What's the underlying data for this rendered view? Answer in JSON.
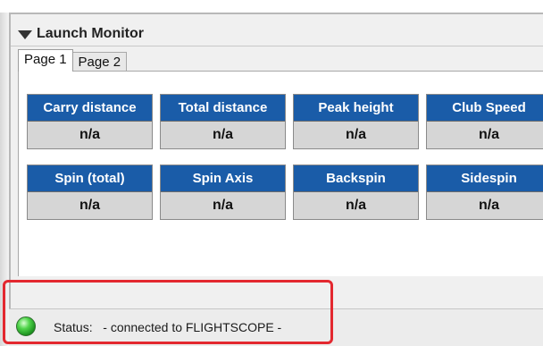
{
  "panel": {
    "title": "Launch Monitor"
  },
  "tabs": [
    {
      "label": "Page 1",
      "active": true
    },
    {
      "label": "Page 2",
      "active": false
    }
  ],
  "metrics_row1": [
    {
      "label": "Carry distance",
      "value": "n/a"
    },
    {
      "label": "Total distance",
      "value": "n/a"
    },
    {
      "label": "Peak height",
      "value": "n/a"
    },
    {
      "label": "Club Speed",
      "value": "n/a"
    }
  ],
  "metrics_row2": [
    {
      "label": "Spin (total)",
      "value": "n/a"
    },
    {
      "label": "Spin Axis",
      "value": "n/a"
    },
    {
      "label": "Backspin",
      "value": "n/a"
    },
    {
      "label": "Sidespin",
      "value": "n/a"
    }
  ],
  "status": {
    "label": "Status:",
    "text": "- connected to FLIGHTSCOPE -",
    "led_color": "#3cc43a"
  },
  "colors": {
    "metric_header": "#1a5ca8",
    "metric_value_bg": "#d6d6d6",
    "annotation_border": "#e3282f"
  }
}
